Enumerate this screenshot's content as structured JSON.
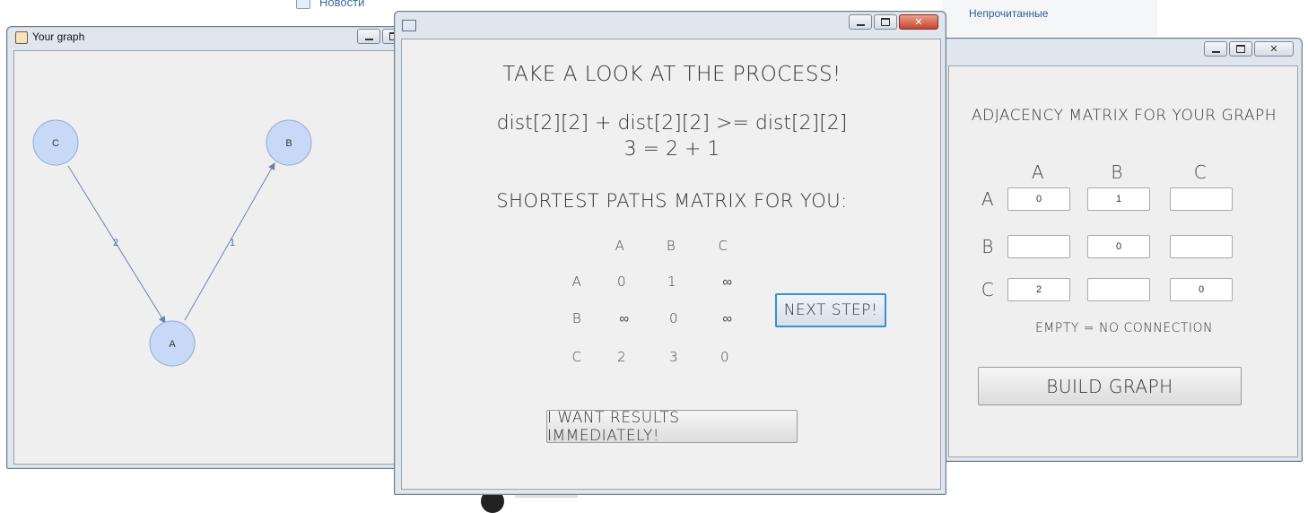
{
  "background": {
    "news_link": "Новости",
    "unread_link": "Непрочитанные"
  },
  "graph_window": {
    "title": "Your graph",
    "nodes": [
      "C",
      "B",
      "A"
    ],
    "edges": [
      {
        "from": "C",
        "to": "A",
        "weight": "2"
      },
      {
        "from": "A",
        "to": "B",
        "weight": "1"
      }
    ]
  },
  "process_window": {
    "heading": "TAKE A LOOK AT THE PROCESS!",
    "formula_line1": "dist[2][2] + dist[2][2] >= dist[2][2]",
    "formula_line2": "3 = 2 + 1",
    "matrix_title": "SHORTEST PATHS MATRIX FOR YOU:",
    "matrix": {
      "col_headers": [
        "A",
        "B",
        "C"
      ],
      "row_headers": [
        "A",
        "B",
        "C"
      ],
      "rows": [
        [
          "0",
          "1",
          "∞"
        ],
        [
          "∞",
          "0",
          "∞"
        ],
        [
          "2",
          "3",
          "0"
        ]
      ]
    },
    "next_step_label": "NEXT STEP!",
    "results_label": "I WANT RESULTS IMMEDIATELY!"
  },
  "adjacency_window": {
    "heading": "ADJACENCY MATRIX FOR YOUR GRAPH",
    "col_headers": [
      "A",
      "B",
      "C"
    ],
    "row_headers": [
      "A",
      "B",
      "C"
    ],
    "values": [
      [
        "0",
        "1",
        ""
      ],
      [
        "",
        "0",
        ""
      ],
      [
        "2",
        "",
        "0"
      ]
    ],
    "note": "EMPTY = NO CONNECTION",
    "build_label": "BUILD GRAPH"
  },
  "colors": {
    "node_fill": "#c7d9f7",
    "node_stroke": "#8ea9d8",
    "edge": "#6b82b0",
    "focus_border": "#3c8fd0",
    "close_button": "#c9442c"
  }
}
